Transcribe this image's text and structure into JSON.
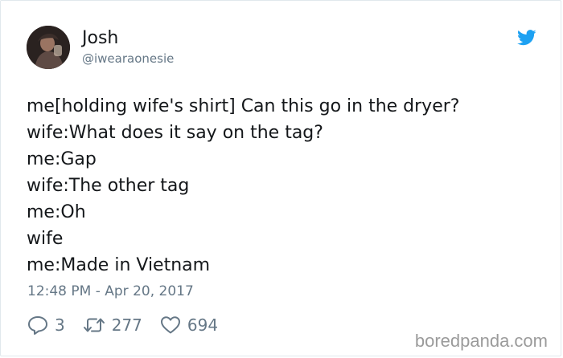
{
  "user": {
    "name": "Josh",
    "handle": "@iwearaonesie",
    "avatar_icon": "avatar-photo"
  },
  "brand_icon": "twitter-bird-icon",
  "brand_color": "#1da1f2",
  "tweet": {
    "lines": [
      "me[holding wife's shirt] Can this go in the dryer?",
      "wife:What does it say on the tag?",
      "me:Gap",
      "wife:The other tag",
      "me:Oh",
      "wife",
      "me:Made in Vietnam"
    ],
    "timestamp": "12:48 PM - Apr 20, 2017"
  },
  "actions": {
    "reply_count": "3",
    "retweet_count": "277",
    "like_count": "694"
  },
  "watermark": "boredpanda.com"
}
